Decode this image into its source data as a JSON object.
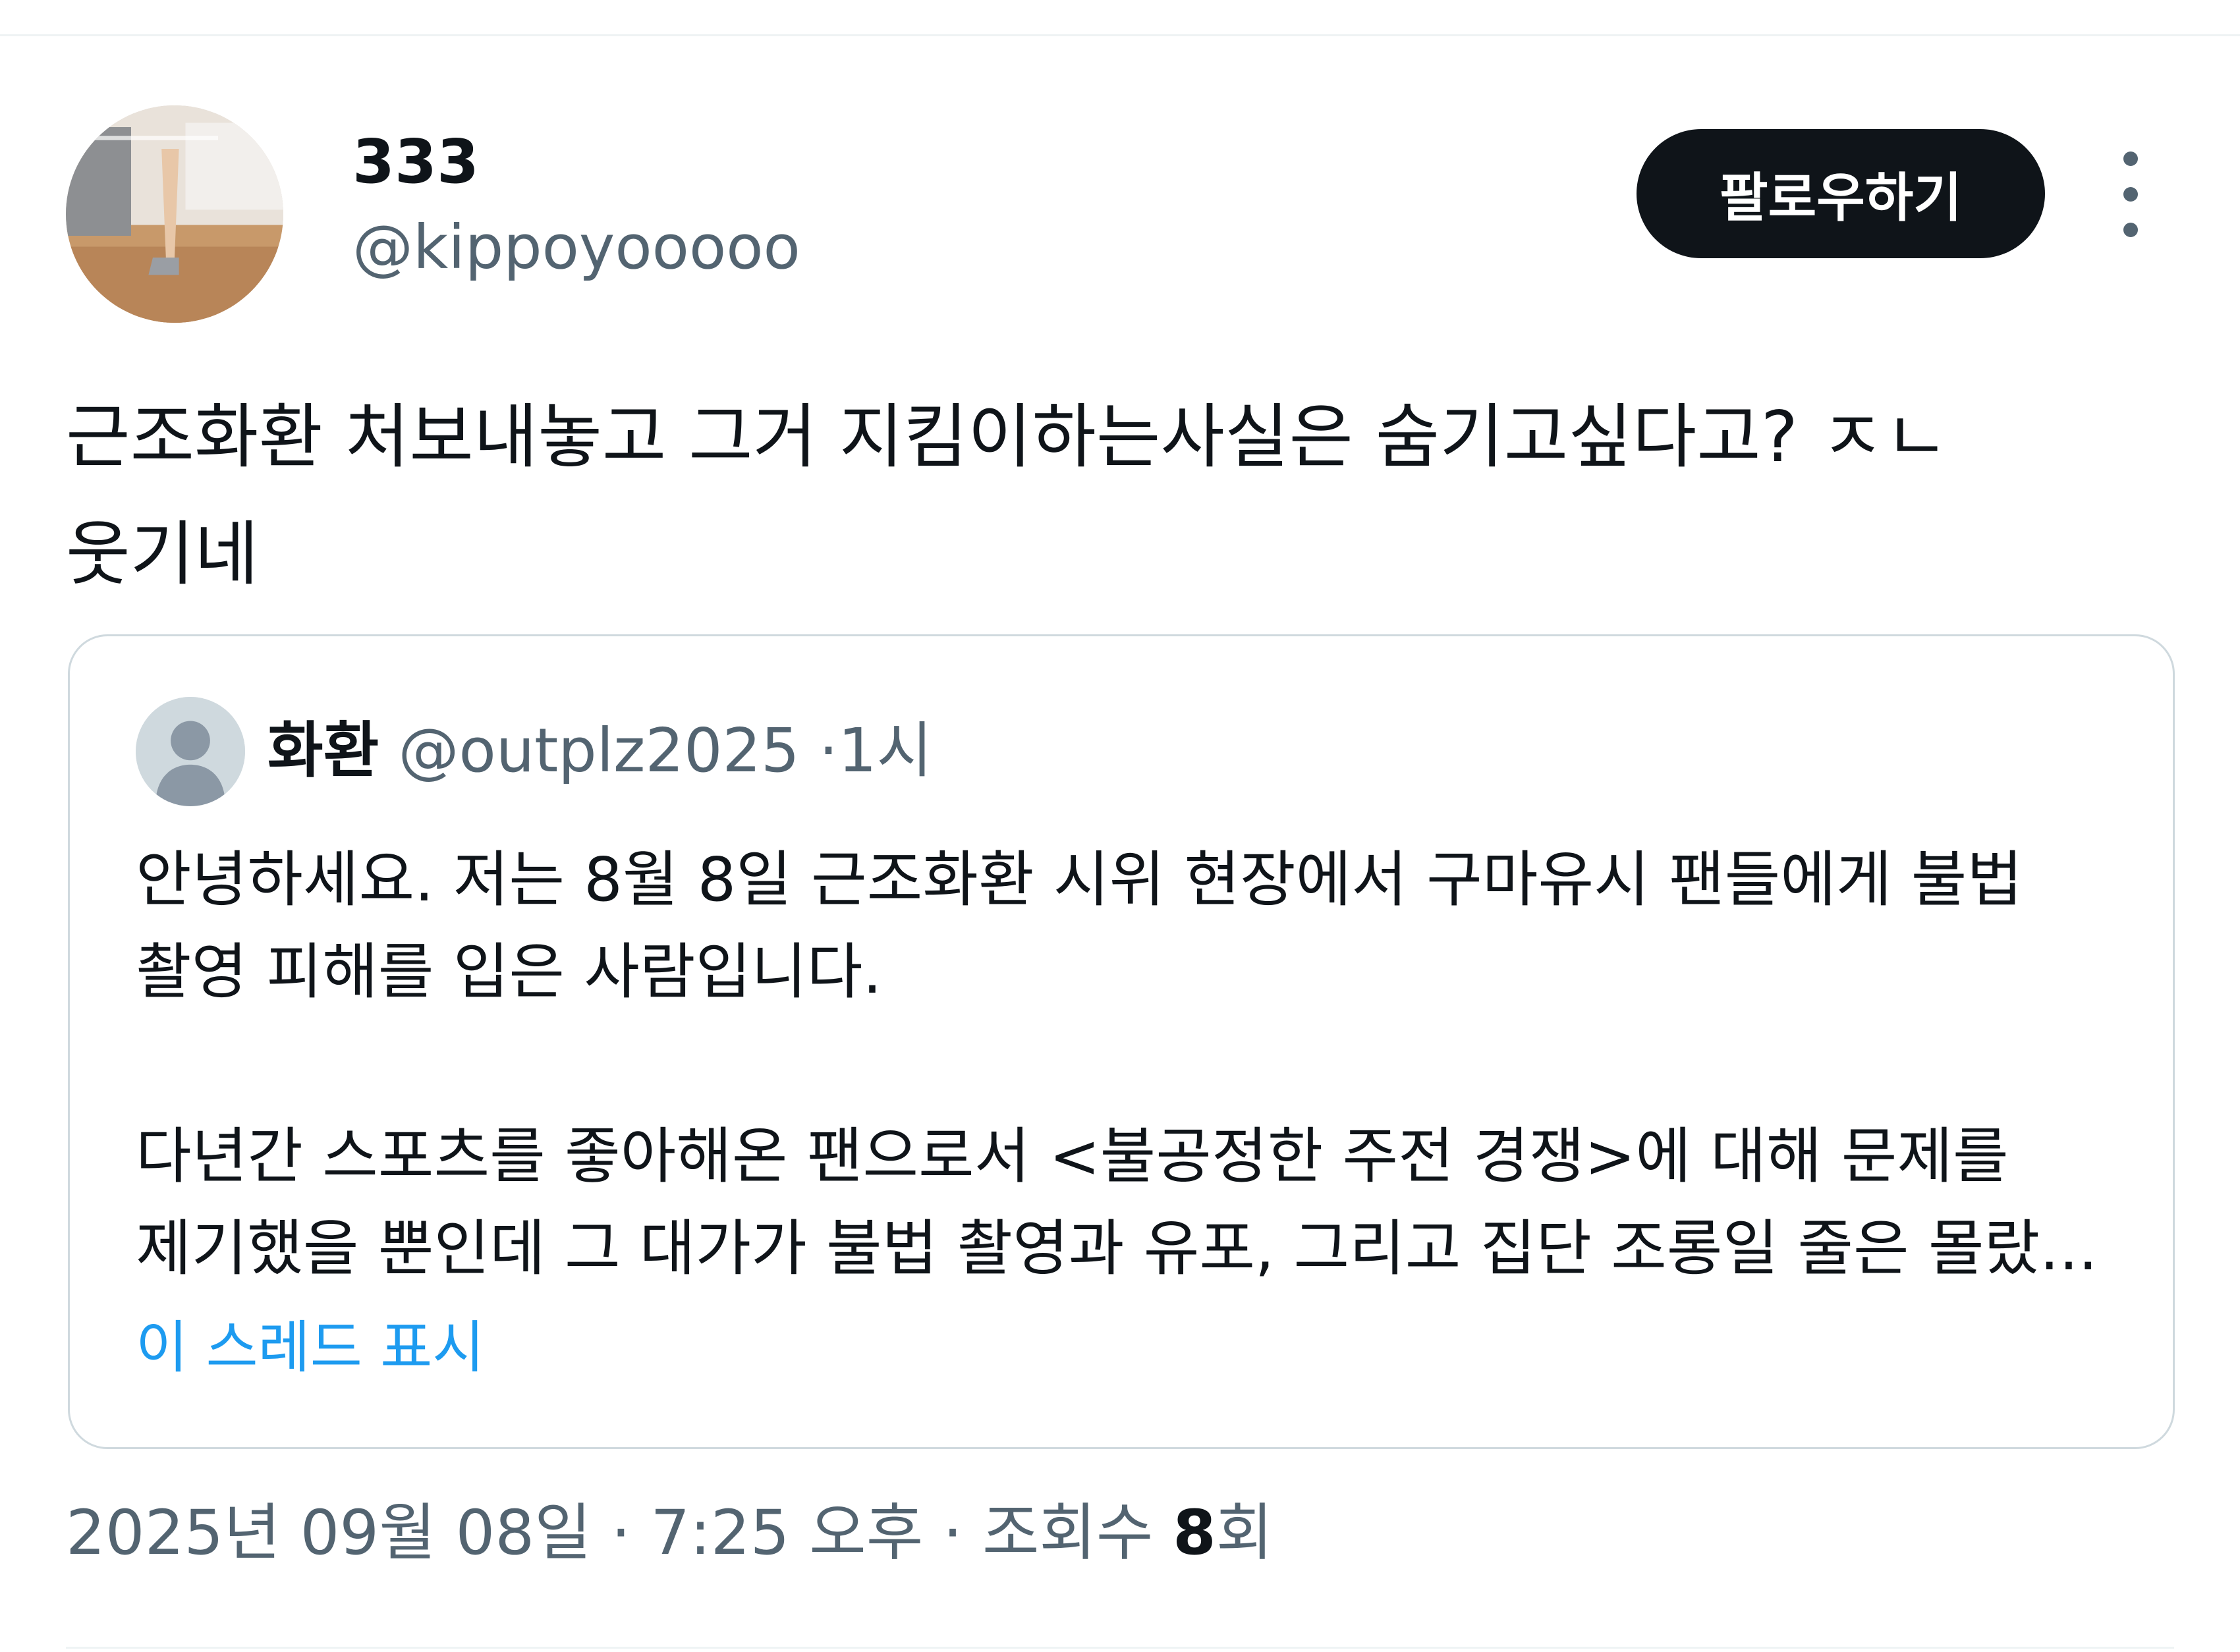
{
  "author": {
    "display_name": "333",
    "handle": "@kippoyooooo"
  },
  "follow_button_label": "팔로우하기",
  "tweet_text": "근조화환 처보내놓고 그거 지킴이하는사실은 숨기고싶다고? ㅈㄴ\n웃기네",
  "quoted_tweet": {
    "display_name": "화환",
    "handle": "@outplz2025",
    "separator": "·",
    "time": "1시",
    "text": "안녕하세요. 저는 8월 8일 근조화환 시위 현장에서 구마유시 팬들에게 불법\n촬영 피해를 입은 사람입니다.\n\n다년간 스포츠를 좋아해온 팬으로서 <불공정한 주전 경쟁>에 대해 문제를\n제기했을 뿐인데 그 대가가 불법 촬영과 유포, 그리고 집단 조롱일 줄은 몰랐...",
    "show_thread_label": "이 스레드 표시"
  },
  "meta": {
    "date": "2025년 09월 08일",
    "separator1": "·",
    "time": "7:25 오후",
    "separator2": "·",
    "views_label": "조회수",
    "views_count": "8",
    "views_suffix": "회"
  },
  "colors": {
    "text_primary": "#0f1419",
    "text_secondary": "#536471",
    "link": "#1d9bf0",
    "border": "#cfd9de",
    "button_bg": "#0f1419"
  },
  "icons": {
    "more": "more-vertical-icon",
    "default_avatar": "default-avatar-icon"
  }
}
